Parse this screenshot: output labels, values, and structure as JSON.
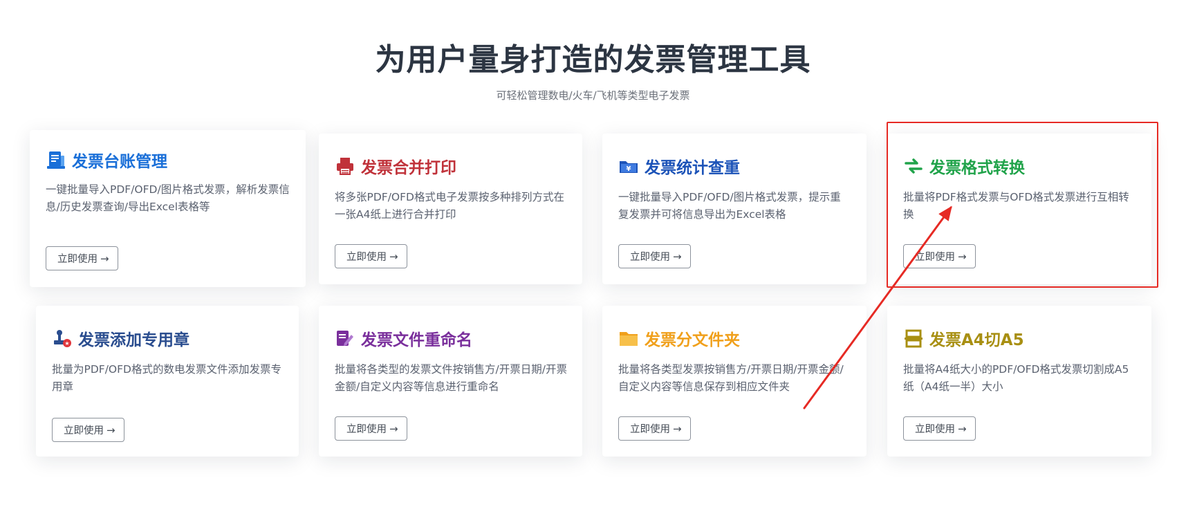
{
  "hero": {
    "title": "为用户量身打造的发票管理工具",
    "subtitle": "可轻松管理数电/火车/飞机等类型电子发票"
  },
  "cards": [
    {
      "title": "发票台账管理",
      "title_color": "#1a6fd8",
      "icon": "ledger-icon",
      "description": "一键批量导入PDF/OFD/图片格式发票，解析发票信息/历史发票查询/导出Excel表格等",
      "button_label": "立即使用",
      "button_arrow": "→"
    },
    {
      "title": "发票合并打印",
      "title_color": "#c0323a",
      "icon": "printer-icon",
      "description": "将多张PDF/OFD格式电子发票按多种排列方式在一张A4纸上进行合并打印",
      "button_label": "立即使用",
      "button_arrow": "→"
    },
    {
      "title": "发票统计查重",
      "title_color": "#1c53b8",
      "icon": "folder-yen-icon",
      "description": "一键批量导入PDF/OFD/图片格式发票，提示重复发票并可将信息导出为Excel表格",
      "button_label": "立即使用",
      "button_arrow": "→"
    },
    {
      "title": "发票格式转换",
      "title_color": "#20a34a",
      "icon": "swap-arrows-icon",
      "description": "批量将PDF格式发票与OFD格式发票进行互相转换",
      "button_label": "立即使用",
      "button_arrow": "→"
    },
    {
      "title": "发票添加专用章",
      "title_color": "#2a4d8f",
      "icon": "stamp-icon",
      "description": "批量为PDF/OFD格式的数电发票文件添加发票专用章",
      "button_label": "立即使用",
      "button_arrow": "→"
    },
    {
      "title": "发票文件重命名",
      "title_color": "#7a2f9c",
      "icon": "edit-document-icon",
      "description": "批量将各类型的发票文件按销售方/开票日期/开票金额/自定义内容等信息进行重命名",
      "button_label": "立即使用",
      "button_arrow": "→"
    },
    {
      "title": "发票分文件夹",
      "title_color": "#f0a01c",
      "icon": "folder-icon",
      "description": "批量将各类型发票按销售方/开票日期/开票金额/自定义内容等信息保存到相应文件夹",
      "button_label": "立即使用",
      "button_arrow": "→"
    },
    {
      "title": "发票A4切A5",
      "title_color": "#a88f12",
      "icon": "cut-paper-icon",
      "description": "批量将A4纸大小的PDF/OFD格式发票切割成A5纸（A4纸一半）大小",
      "button_label": "立即使用",
      "button_arrow": "→"
    }
  ],
  "colors": {
    "highlight": "#e62a24",
    "title_text": "#2c3542"
  }
}
